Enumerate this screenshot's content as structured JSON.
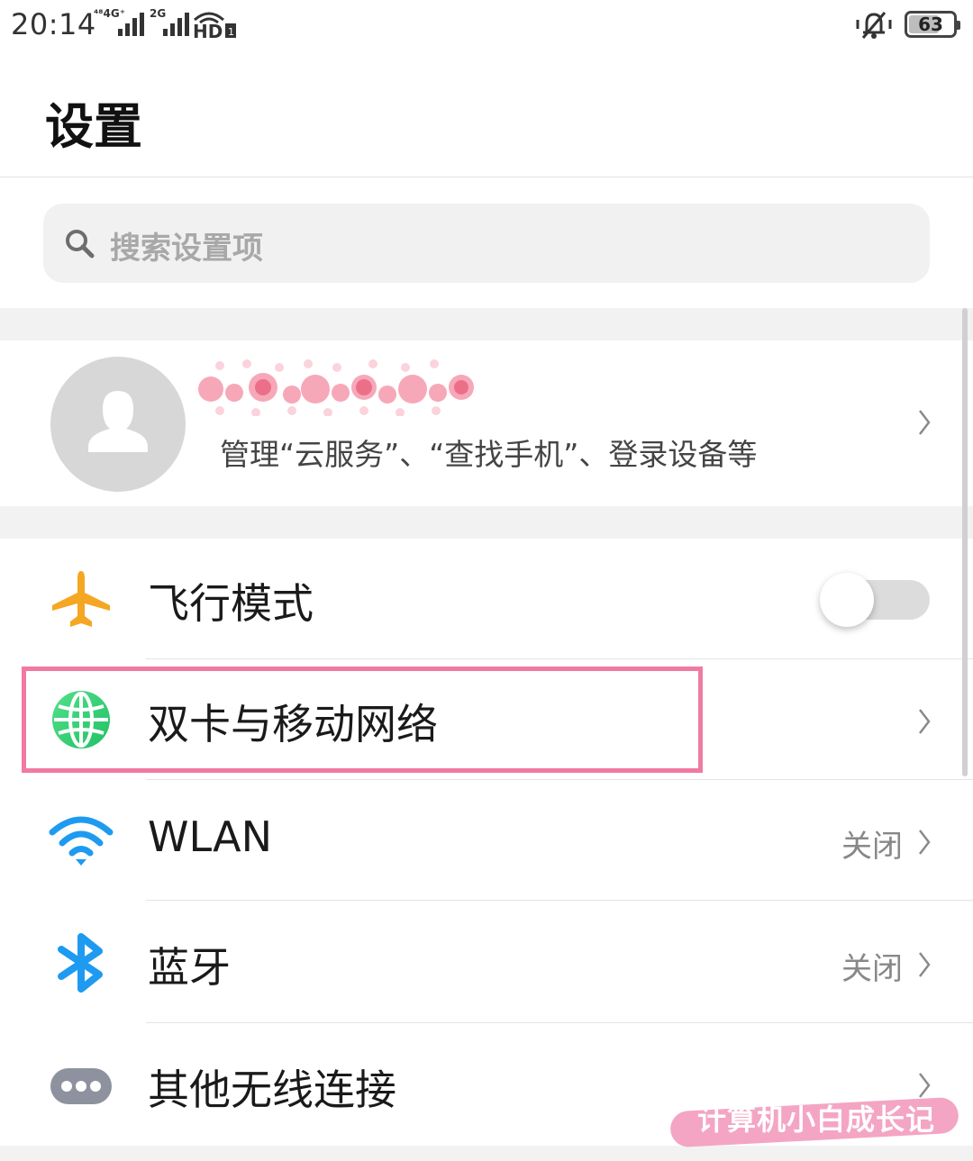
{
  "status_bar": {
    "time": "20:14",
    "sim1_label": "⁴⁸4G⁺",
    "sim2_label": "2G",
    "hd_label": "HD",
    "battery": "63",
    "battery_level": 0.63
  },
  "header": {
    "title": "设置"
  },
  "search": {
    "placeholder": "搜索设置项"
  },
  "account": {
    "description": "管理“云服务”、“查找手机”、登录设备等"
  },
  "items": [
    {
      "label": "飞行模式",
      "icon": "airplane-icon",
      "toggle_on": false
    },
    {
      "label": "双卡与移动网络",
      "icon": "globe-icon"
    },
    {
      "label": "WLAN",
      "icon": "wifi-icon",
      "value": "关闭"
    },
    {
      "label": "蓝牙",
      "icon": "bluetooth-icon",
      "value": "关闭"
    },
    {
      "label": "其他无线连接",
      "icon": "more-connections-icon"
    }
  ],
  "watermark": {
    "text": "计算机小白成长记"
  },
  "colors": {
    "airplane": "#f5a623",
    "globe": "#3cd27a",
    "wifi": "#1e9bf0",
    "bluetooth": "#1e9bf0",
    "more": "#8e929e",
    "highlight": "#f07aa0"
  }
}
